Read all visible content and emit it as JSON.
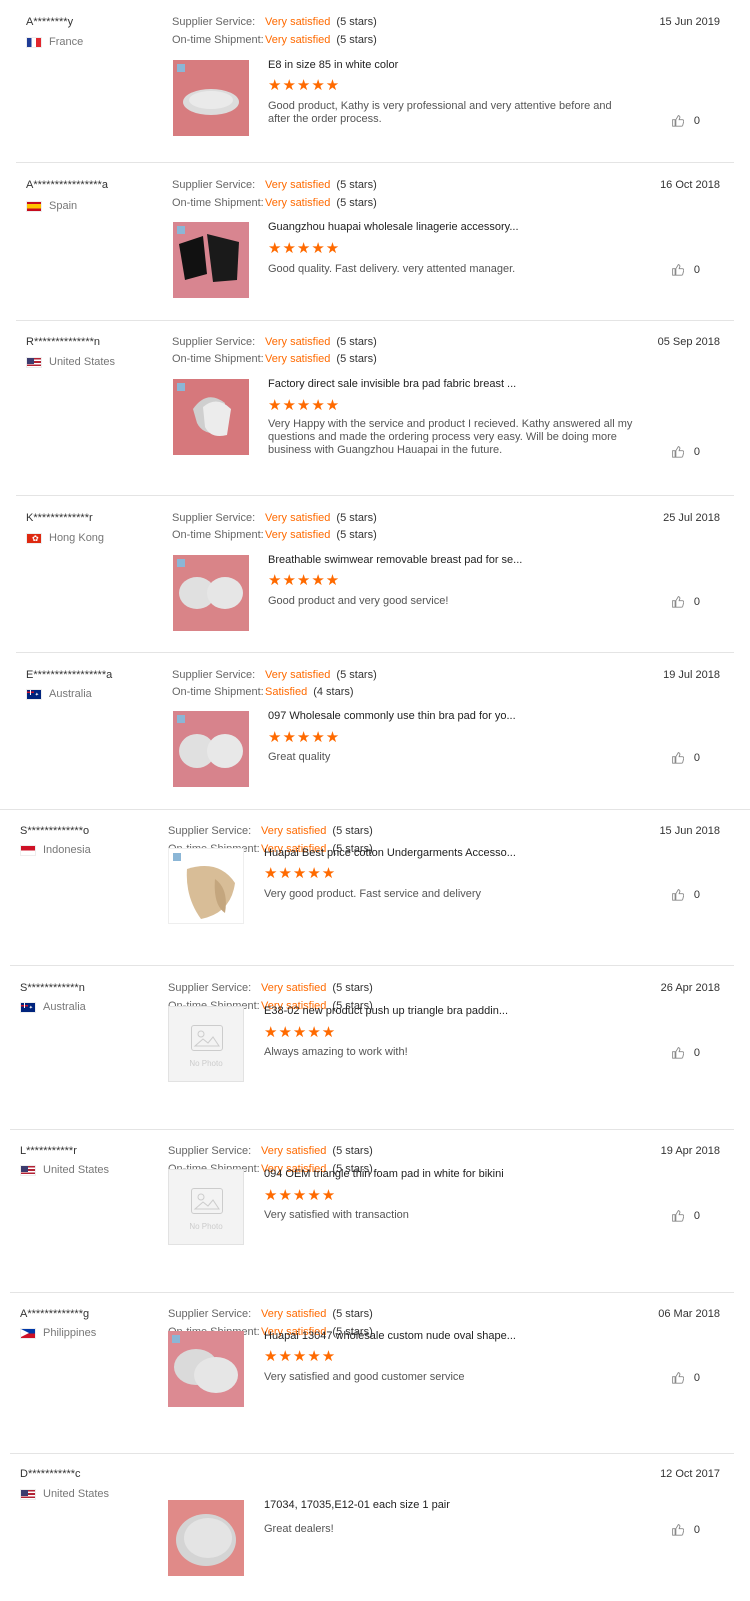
{
  "labels": {
    "supplier_service": "Supplier Service:",
    "ontime_shipment": "On-time Shipment:",
    "no_photo": "No Photo"
  },
  "colors": {
    "accent": "#ff6a00",
    "separator": "#e4e4e4"
  },
  "reviews": [
    {
      "buyer": "A********y",
      "country": "France",
      "flag": "flag-fr",
      "date": "15 Jun 2019",
      "supplier_value": "Very satisfied",
      "supplier_stars": "(5 stars)",
      "shipment_value": "Very satisfied",
      "shipment_stars": "(5 stars)",
      "product": "E8 in size 85 in white color",
      "rating": "★★★★★",
      "comment": "Good product, Kathy is very professional and very attentive before and after the order process.",
      "likes": "0",
      "image": "photo"
    },
    {
      "buyer": "A****************a",
      "country": "Spain",
      "flag": "flag-es",
      "date": "16 Oct 2018",
      "supplier_value": "Very satisfied",
      "supplier_stars": "(5 stars)",
      "shipment_value": "Very satisfied",
      "shipment_stars": "(5 stars)",
      "product": "Guangzhou huapai wholesale linagerie accessory...",
      "rating": "★★★★★",
      "comment": "Good quality. Fast delivery. very attented manager.",
      "likes": "0",
      "image": "photo"
    },
    {
      "buyer": "R**************n",
      "country": "United States",
      "flag": "flag-us",
      "date": "05 Sep 2018",
      "supplier_value": "Very satisfied",
      "supplier_stars": "(5 stars)",
      "shipment_value": "Very satisfied",
      "shipment_stars": "(5 stars)",
      "product": "Factory direct sale invisible bra pad fabric breast ...",
      "rating": "★★★★★",
      "comment": "Very Happy with the service and product I recieved. Kathy answered all my questions and made the ordering process very easy. Will be doing more business with Guangzhou Hauapai in the future.",
      "likes": "0",
      "image": "photo"
    },
    {
      "buyer": "K*************r",
      "country": "Hong Kong",
      "flag": "flag-hk",
      "date": "25 Jul 2018",
      "supplier_value": "Very satisfied",
      "supplier_stars": "(5 stars)",
      "shipment_value": "Very satisfied",
      "shipment_stars": "(5 stars)",
      "product": "Breathable swimwear removable breast pad for se...",
      "rating": "★★★★★",
      "comment": "Good product and very good service!",
      "likes": "0",
      "image": "photo"
    },
    {
      "buyer": "E*****************a",
      "country": "Australia",
      "flag": "flag-au",
      "date": "19 Jul 2018",
      "supplier_value": "Very satisfied",
      "supplier_stars": "(5 stars)",
      "shipment_value": "Satisfied",
      "shipment_stars": "(4 stars)",
      "product": "097 Wholesale commonly use thin bra pad for yo...",
      "rating": "★★★★★",
      "comment": "Great quality",
      "likes": "0",
      "image": "photo"
    },
    {
      "buyer": "S*************o",
      "country": "Indonesia",
      "flag": "flag-id",
      "date": "15 Jun 2018",
      "supplier_value": "Very satisfied",
      "supplier_stars": "(5 stars)",
      "shipment_value": "Very satisfied",
      "shipment_stars": "(5 stars)",
      "product": "Huapai Best price cotton Undergarments Accesso...",
      "rating": "★★★★★",
      "comment": "Very good product. Fast service and delivery",
      "likes": "0",
      "image": "beige"
    },
    {
      "buyer": "S************n",
      "country": "Australia",
      "flag": "flag-au",
      "date": "26 Apr 2018",
      "supplier_value": "Very satisfied",
      "supplier_stars": "(5 stars)",
      "shipment_value": "Very satisfied",
      "shipment_stars": "(5 stars)",
      "product": "E38-02 new product push up triangle bra paddin...",
      "rating": "★★★★★",
      "comment": "Always amazing to work with!",
      "likes": "0",
      "image": "nophoto"
    },
    {
      "buyer": "L***********r",
      "country": "United States",
      "flag": "flag-us",
      "date": "19 Apr 2018",
      "supplier_value": "Very satisfied",
      "supplier_stars": "(5 stars)",
      "shipment_value": "Very satisfied",
      "shipment_stars": "(5 stars)",
      "product": "094 OEM triangle thin foam pad in white for bikini",
      "rating": "★★★★★",
      "comment": "Very satisfied with transaction",
      "likes": "0",
      "image": "nophoto"
    },
    {
      "buyer": "A*************g",
      "country": "Philippines",
      "flag": "flag-ph",
      "date": "06 Mar 2018",
      "supplier_value": "Very satisfied",
      "supplier_stars": "(5 stars)",
      "shipment_value": "Very satisfied",
      "shipment_stars": "(5 stars)",
      "product": "Huapai 13047 wholesale custom nude oval shape...",
      "rating": "★★★★★",
      "comment": "Very satisfied and good customer service",
      "likes": "0",
      "image": "photo"
    },
    {
      "buyer": "D***********c",
      "country": "United States",
      "flag": "flag-us",
      "date": "12 Oct 2017",
      "product": "17034, 17035,E12-01 each size 1 pair",
      "comment": "Great dealers!",
      "likes": "0",
      "image": "photo"
    }
  ]
}
